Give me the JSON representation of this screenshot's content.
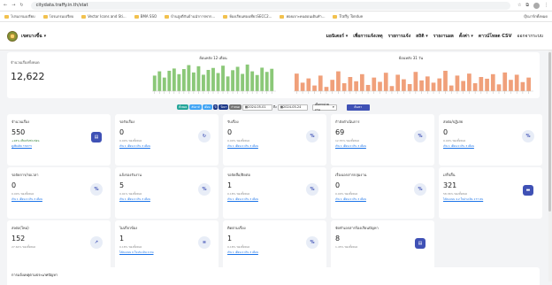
{
  "browser": {
    "url": "citydata.traffy.in.th/stat",
    "all_bookmarks": "บุ๊กมาร์กทั้งหมด"
  },
  "bookmarks": [
    "โปรแกรมเปรียบ",
    "โปรแกรมเปรียบ",
    "Vector Icons and Sti...",
    "BMA SSO",
    "บ้านสูงตีกันบ้านนำการพาก...",
    "ห้องเรียนท่องเที่ยวSECC2...",
    "ห่อยเจาะคนตอนเดินทำ...",
    "Traffy Tondue"
  ],
  "header": {
    "org_name": "เขตบางขี้ฉ",
    "menu": [
      "มอนิเตอร์",
      "เพื่อการแจ้งเหตุ",
      "รายการแจ้ง",
      "สถิติ",
      "รายงานผล",
      "ตั้งค่า",
      "ดาวน์โหลด CSV",
      "ออกจากระบบ"
    ]
  },
  "summary": {
    "label": "จำนวนเรื่องทั้งหมด",
    "value": "12,622"
  },
  "chart_data": [
    {
      "type": "bar",
      "title": "ย้อนหลัง 12 เดือน",
      "values": [
        55,
        70,
        48,
        72,
        80,
        60,
        78,
        92,
        66,
        88,
        58,
        75,
        82,
        64,
        90,
        52,
        74,
        86,
        61,
        94,
        70,
        57,
        83,
        68,
        79
      ]
    },
    {
      "type": "bar",
      "title": "ย้อนหลัง 31 วัน",
      "values": [
        62,
        30,
        45,
        20,
        55,
        15,
        40,
        70,
        28,
        50,
        35,
        60,
        22,
        48,
        33,
        65,
        18,
        58,
        42,
        25,
        68,
        38,
        52,
        30,
        45,
        72,
        20,
        55,
        36,
        62,
        28,
        50,
        44,
        60,
        24,
        66,
        40,
        58,
        32,
        48
      ]
    }
  ],
  "filters": {
    "pills": [
      {
        "label": "ทั้งหมด",
        "color": "#26a69a"
      },
      {
        "label": "สัปดาห์",
        "color": "#42a5f5"
      },
      {
        "label": "เดือน",
        "color": "#42a5f5"
      },
      {
        "label": "ปี",
        "color": "#1e3a8a"
      },
      {
        "label": "ปีงบฯ",
        "color": "#1e3a8a"
      },
      {
        "label": "กำหนด",
        "color": "#757575"
      }
    ],
    "start_date": "2024-05-01",
    "end_date": "2024-05-24",
    "to": "ถึง",
    "select": "เลือกหน่วยงาน",
    "search": "ค้นหา"
  },
  "cards": [
    {
      "title": "จำนวนเรื่อง",
      "value": "550",
      "line1": "+18% เทียบกับช่วงก่อน",
      "line2": "ดูเพิ่มเติม รายการ",
      "icon": "document-icon",
      "solid": true,
      "pos": "1"
    },
    {
      "title": "รอรับเรื่อง",
      "value": "0",
      "line1": "0.00% ของทั้งหมด",
      "line2": "เกิน 1 เดือน 0 เกิน 3 เดือน",
      "icon": "refresh-icon",
      "pos": "2"
    },
    {
      "title": "รับเรื่อง",
      "value": "0",
      "line1": "0.00% ของทั้งหมด",
      "line2": "เกิน 1 เดือน 0 เกิน 3 เดือน",
      "icon": "percent-icon",
      "pos": "3"
    },
    {
      "title": "กำลังดำเนินการ",
      "value": "69",
      "line1": "12.55% ของทั้งหมด",
      "line2": "เกิน 1 เดือน 0 เกิน 3 เดือน",
      "icon": "percent-icon",
      "pos": "4"
    },
    {
      "title": "ส่งต่อ/ปฏิเสธ",
      "value": "0",
      "line1": "0.00% ของทั้งหมด",
      "line2": "เกิน 1 เดือน 0 เกิน 3 เดือน",
      "icon": "percent-icon",
      "pos": "5"
    },
    {
      "title": "รอจัดการ/รอเวลา",
      "value": "0",
      "line1": "0.00% ของทั้งหมด",
      "line2": "เกิน 1 เดือน 0 เกิน 3 เดือน",
      "icon": "percent-icon",
      "pos": "6"
    },
    {
      "title": "แจ้งรองรับงาน",
      "value": "5",
      "line1": "0.91% ของทั้งหมด",
      "line2": "เกิน 1 เดือน 0 เกิน 3 เดือน",
      "icon": "percent-icon",
      "pos": "7"
    },
    {
      "title": "รอจัดสื่อ/ติดต่อ",
      "value": "1",
      "line1": "0.18% ของทั้งหมด",
      "line2": "เกิน 1 เดือน 0 เกิน 3 เดือน",
      "icon": "percent-icon",
      "pos": "8"
    },
    {
      "title": "เรื่องเอกสารกลุ่มงาน",
      "value": "0",
      "line1": "0.00% ของทั้งหมด",
      "line2": "เกิน 1 เดือน 0 เกิน 3 เดือน",
      "icon": "percent-icon",
      "pos": "9"
    },
    {
      "title": "เสร็จสิ้น",
      "value": "321",
      "line1": "58.36% ของทั้งหมด",
      "line2": "ได้คะแนน 4.2 ในประเมิน 177 คน",
      "icon": "chat-icon",
      "solid": true,
      "pos": "10"
    },
    {
      "title": "ส่งต่อ(ใหม่)",
      "value": "152",
      "line1": "27.64% ของทั้งหมด",
      "line2": "",
      "icon": "share-icon",
      "pos": "11"
    },
    {
      "title": "ไม่เกี่ยวข้อง",
      "value": "1",
      "line1": "0.18% ของทั้งหมด",
      "line2": "ได้คะแนน 0 ในประเมิน 0 คน",
      "icon": "list-icon",
      "pos": "12"
    },
    {
      "title": "ติดตามเรื่อง",
      "value": "1",
      "line1": "0.18% ของทั้งหมด",
      "line2": "เกิน 1 เดือน 0 เกิน 3 เดือน",
      "icon": "percent-icon",
      "pos": "13"
    },
    {
      "title": "จัดทำเอกสารร้องเรียนปัญหา",
      "value": "8",
      "line1": "1.45% ของทั้งหมด",
      "line2": "",
      "icon": "document-icon",
      "solid": true,
      "pos": "14"
    }
  ],
  "footer": {
    "title": "การแจ้งเหตุตามประเภทปัญหา"
  }
}
